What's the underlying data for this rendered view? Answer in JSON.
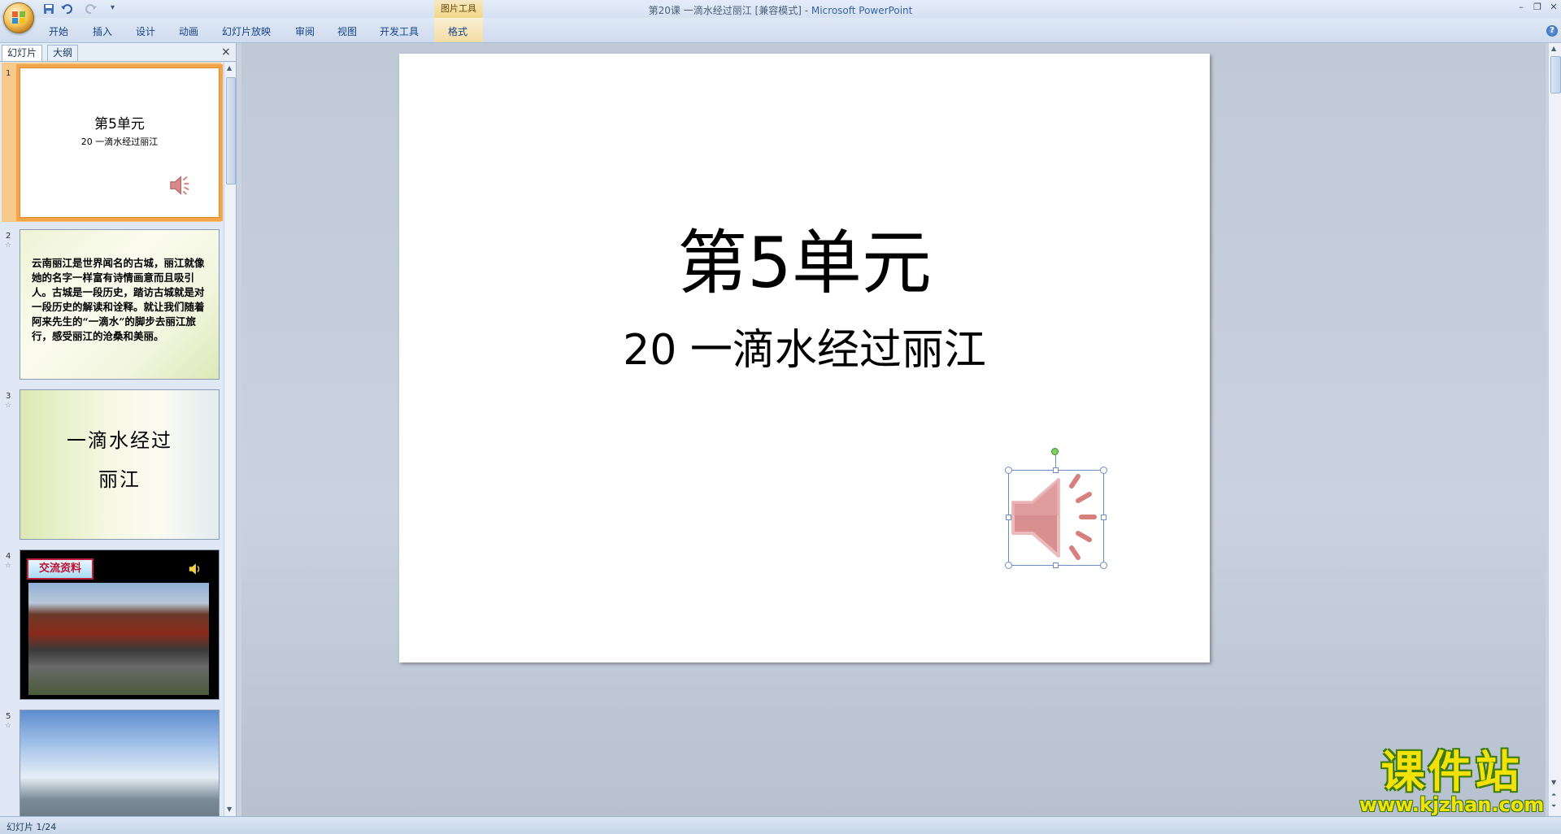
{
  "window": {
    "title": "第20课 一滴水经过丽江 [兼容模式] - ",
    "app_name": "Microsoft PowerPoint",
    "contextual_tab_group": "图片工具"
  },
  "ribbon": {
    "tabs": [
      "开始",
      "插入",
      "设计",
      "动画",
      "幻灯片放映",
      "审阅",
      "视图",
      "开发工具",
      "格式"
    ]
  },
  "left_pane": {
    "tabs": [
      "幻灯片",
      "大纲"
    ],
    "close_label": "×"
  },
  "thumbnails": [
    {
      "number": "1",
      "title": "第5单元",
      "subtitle": "20  一滴水经过丽江"
    },
    {
      "number": "2",
      "text": "云南丽江是世界闻名的古城，丽江就像她的名字一样富有诗情画意而且吸引人。古城是一段历史，踏访古城就是对一段历史的解读和诠释。就让我们随着阿来先生的“一滴水”的脚步去丽江旅行，感受丽江的沧桑和美丽。"
    },
    {
      "number": "3",
      "title_line1": "一滴水经过",
      "title_line2": "丽江"
    },
    {
      "number": "4",
      "badge": "交流资料"
    },
    {
      "number": "5"
    }
  ],
  "slide": {
    "title": "第5单元",
    "subtitle": "20  一滴水经过丽江"
  },
  "status_bar": {
    "slide_indicator": "幻灯片 1/24"
  },
  "watermark": {
    "title": "课件站",
    "url": "www.kjzhan.com"
  },
  "colors": {
    "selected_thumb": "#f4a54a",
    "sound_icon": "#d88a8a",
    "watermark_yellow": "#f2e20a"
  }
}
